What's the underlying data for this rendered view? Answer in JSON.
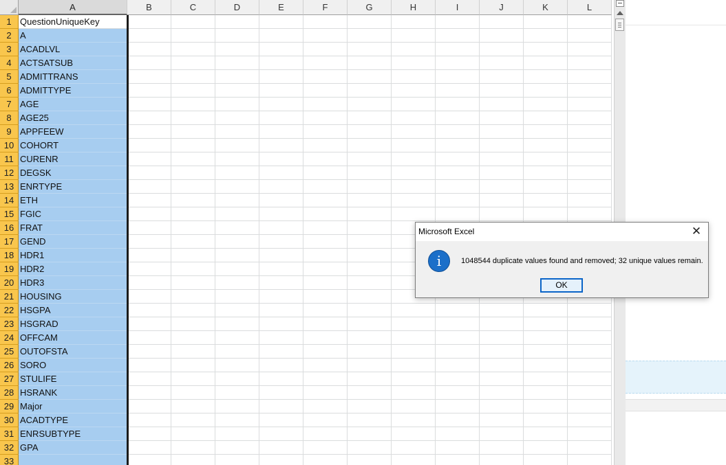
{
  "spreadsheet": {
    "column_headers": [
      "A",
      "B",
      "C",
      "D",
      "E",
      "F",
      "G",
      "H",
      "I",
      "J",
      "K",
      "L"
    ],
    "selected_column": "A",
    "row_numbers": [
      "1",
      "2",
      "3",
      "4",
      "5",
      "6",
      "7",
      "8",
      "9",
      "10",
      "11",
      "12",
      "13",
      "14",
      "15",
      "16",
      "17",
      "18",
      "19",
      "20",
      "21",
      "22",
      "23",
      "24",
      "25",
      "26",
      "27",
      "28",
      "29",
      "30",
      "31",
      "32",
      "33"
    ],
    "column_a_values": [
      "QuestionUniqueKey",
      "A",
      "ACADLVL",
      "ACTSATSUB",
      "ADMITTRANS",
      "ADMITTYPE",
      "AGE",
      "AGE25",
      "APPFEEW",
      "COHORT",
      "CURENR",
      "DEGSK",
      "ENRTYPE",
      "ETH",
      "FGIC",
      "FRAT",
      "GEND",
      "HDR1",
      "HDR2",
      "HDR3",
      "HOUSING",
      "HSGPA",
      "HSGRAD",
      "OFFCAM",
      "OUTOFSTA",
      "SORO",
      "STULIFE",
      "HSRANK",
      "Major",
      "ACADTYPE",
      "ENRSUBTYPE",
      "GPA",
      ""
    ]
  },
  "dialog": {
    "title": "Microsoft Excel",
    "close_glyph": "✕",
    "icon": "information-icon",
    "icon_glyph": "i",
    "message": "1048544 duplicate values found and removed; 32 unique values remain.",
    "ok_label": "OK"
  },
  "colors": {
    "selection_fill": "#a7cdf0",
    "row_header_selected": "#f9c64d",
    "dialog_button_border": "#0a64c8",
    "info_icon": "#1b6fc9"
  }
}
